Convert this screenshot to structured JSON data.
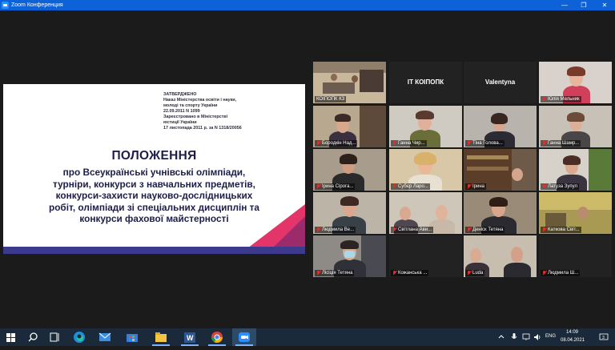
{
  "window": {
    "title": "Zoom Конференция",
    "minimize_label": "—",
    "maximize_label": "❐",
    "close_label": "✕"
  },
  "slide": {
    "approval_lines": [
      "ЗАТВЕРДЖЕНО",
      "Наказ Міністерства освіти і науки,",
      "молоді та спорту України",
      "22.09.2011 N 1099",
      "Зареєстровано в Міністерстві",
      "юстиції України",
      "17 листопада 2011 р. за N 1318/20056"
    ],
    "heading": "ПОЛОЖЕННЯ",
    "subtitle_lines": [
      "про Всеукраїнські учнівські олімпіади,",
      "турніри, конкурси з навчальних предметів,",
      "конкурси-захисти науково-дослідницьких",
      "робіт, олімпіади зі спеціальних дисциплін та",
      "конкурси фахової майстерності"
    ]
  },
  "participants": [
    {
      "label": "КОІПОПК КЗ",
      "kind": "room",
      "active": true,
      "muted": false
    },
    {
      "label": "IT КОІПОПК",
      "kind": "name"
    },
    {
      "label": "Valentyna",
      "kind": "name"
    },
    {
      "label": "Юлія Мельник",
      "kind": "video",
      "muted": true
    },
    {
      "label": "Бородкін Над...",
      "kind": "video",
      "muted": true
    },
    {
      "label": "Ганна Чир...",
      "kind": "video",
      "muted": true
    },
    {
      "label": "Тіна Голова...",
      "kind": "video",
      "muted": true
    },
    {
      "label": "Ганна Шамр...",
      "kind": "video",
      "muted": true
    },
    {
      "label": "Ірина Сірога...",
      "kind": "video",
      "muted": true
    },
    {
      "label": "Субєр Ларо...",
      "kind": "video",
      "muted": true
    },
    {
      "label": "Ірина",
      "kind": "video",
      "muted": true
    },
    {
      "label": "Латуза Зупул",
      "kind": "video",
      "muted": true
    },
    {
      "label": "Людмила Ве...",
      "kind": "video",
      "muted": true
    },
    {
      "label": "Світлана Ави...",
      "kind": "video",
      "muted": true
    },
    {
      "label": "Деніск Тетяна",
      "kind": "video",
      "muted": true
    },
    {
      "label": "Каткова Світ...",
      "kind": "video",
      "muted": true
    },
    {
      "label": "Лісіція Тетяна",
      "kind": "video",
      "muted": true
    },
    {
      "label": "Кожанська ...",
      "kind": "video",
      "muted": true
    },
    {
      "label": "Luda",
      "kind": "video",
      "muted": true
    },
    {
      "label": "Людмила Ш...",
      "kind": "video",
      "muted": true
    }
  ],
  "taskbar": {
    "apps": [
      "start-icon",
      "search-icon",
      "task-view-icon",
      "edge-icon",
      "store-icon",
      "file-explorer-icon",
      "word-icon",
      "chrome-icon",
      "zoom-icon"
    ],
    "lang": "ENG",
    "time": "14:09",
    "date": "08.04.2021"
  },
  "colors": {
    "title_bar": "#0c62d6",
    "slide_heading": "#1d1d4a",
    "slide_accent": "#e4356a",
    "active_speaker": "#cfe03a",
    "muted_icon": "#e03030"
  }
}
